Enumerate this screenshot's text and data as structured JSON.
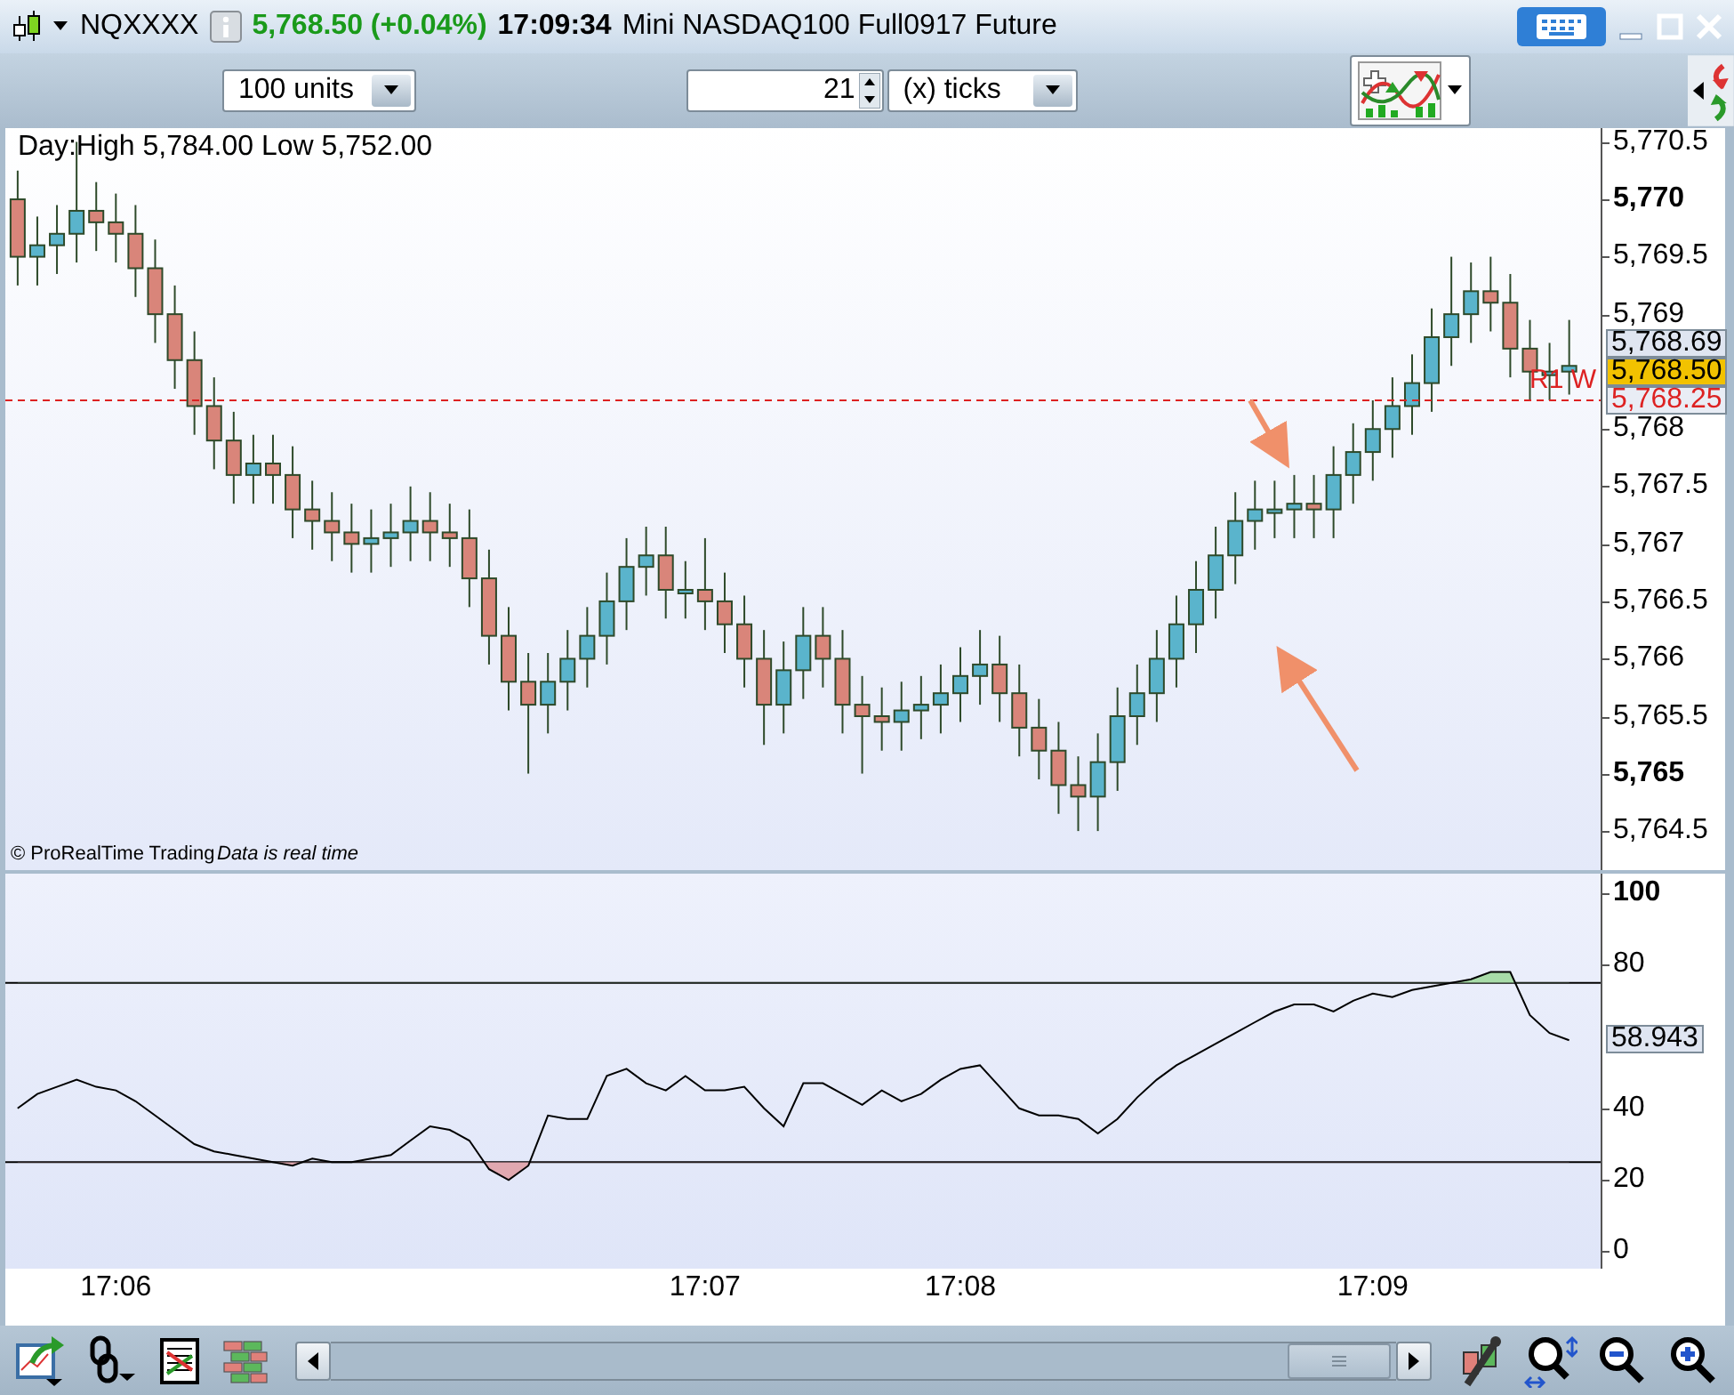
{
  "title_bar": {
    "symbol": "NQXXXX",
    "last_price": "5,768.50 (+0.04%)",
    "time": "17:09:34",
    "description": "Mini NASDAQ100 Full0917 Future"
  },
  "toolbar": {
    "units": "100 units",
    "tick_count": "21",
    "tick_unit": "(x) ticks"
  },
  "price_pane": {
    "day_range": "Day:High 5,784.00 Low 5,752.00",
    "copyright": "© ProRealTime Trading",
    "data_note": "Data is real time",
    "level_label": "R1 W",
    "markers": [
      {
        "kind": "last",
        "text": "5,768.69"
      },
      {
        "kind": "price",
        "text": "5,768.50"
      },
      {
        "kind": "level",
        "text": "5,768.25"
      }
    ],
    "chart_data": {
      "type": "candlestick",
      "ylim": [
        5764.16,
        5770.62
      ],
      "yticks": [
        {
          "value": 5770.5,
          "label": "5,770.5"
        },
        {
          "value": 5770,
          "label": "5,770"
        },
        {
          "value": 5769.5,
          "label": "5,769.5"
        },
        {
          "value": 5769,
          "label": "5,769"
        },
        {
          "value": 5768,
          "label": "5,768"
        },
        {
          "value": 5767.5,
          "label": "5,767.5"
        },
        {
          "value": 5767,
          "label": "5,767"
        },
        {
          "value": 5766.5,
          "label": "5,766.5"
        },
        {
          "value": 5766,
          "label": "5,766"
        },
        {
          "value": 5765.5,
          "label": "5,765.5"
        },
        {
          "value": 5765,
          "label": "5,765"
        },
        {
          "value": 5764.5,
          "label": "5,764.5"
        }
      ],
      "categories": [
        null,
        null,
        null,
        null,
        null,
        null,
        null,
        null,
        null,
        null,
        null,
        null,
        null,
        null,
        null,
        null,
        null,
        null,
        null,
        null,
        null,
        null,
        null,
        null,
        null,
        null,
        null,
        null,
        null,
        null,
        null,
        null,
        null,
        null,
        null,
        null,
        null,
        null,
        null,
        null,
        null,
        null,
        null,
        null,
        null,
        null,
        null,
        null,
        null,
        null,
        null,
        null,
        null,
        null,
        null,
        null,
        null,
        null,
        null,
        null,
        null,
        null,
        null,
        null,
        null,
        null,
        null,
        null,
        null,
        null,
        null,
        null,
        null,
        null,
        null,
        null,
        null,
        null,
        null,
        null
      ],
      "ohlc": [
        [
          5770.0,
          5770.25,
          5769.25,
          5769.5
        ],
        [
          5769.5,
          5769.85,
          5769.25,
          5769.6
        ],
        [
          5769.6,
          5769.95,
          5769.35,
          5769.7
        ],
        [
          5769.7,
          5770.5,
          5769.45,
          5769.9
        ],
        [
          5769.9,
          5770.15,
          5769.55,
          5769.8
        ],
        [
          5769.8,
          5770.05,
          5769.45,
          5769.7
        ],
        [
          5769.7,
          5769.95,
          5769.15,
          5769.4
        ],
        [
          5769.4,
          5769.65,
          5768.75,
          5769.0
        ],
        [
          5769.0,
          5769.25,
          5768.35,
          5768.6
        ],
        [
          5768.6,
          5768.85,
          5767.95,
          5768.2
        ],
        [
          5768.2,
          5768.45,
          5767.65,
          5767.9
        ],
        [
          5767.9,
          5768.15,
          5767.35,
          5767.6
        ],
        [
          5767.6,
          5767.95,
          5767.35,
          5767.7
        ],
        [
          5767.7,
          5767.95,
          5767.35,
          5767.6
        ],
        [
          5767.6,
          5767.85,
          5767.05,
          5767.3
        ],
        [
          5767.3,
          5767.55,
          5766.95,
          5767.2
        ],
        [
          5767.2,
          5767.45,
          5766.85,
          5767.1
        ],
        [
          5767.1,
          5767.35,
          5766.75,
          5767.0
        ],
        [
          5767.0,
          5767.3,
          5766.75,
          5767.05
        ],
        [
          5767.05,
          5767.35,
          5766.8,
          5767.1
        ],
        [
          5767.1,
          5767.5,
          5766.85,
          5767.2
        ],
        [
          5767.2,
          5767.45,
          5766.85,
          5767.1
        ],
        [
          5767.1,
          5767.35,
          5766.8,
          5767.05
        ],
        [
          5767.05,
          5767.3,
          5766.45,
          5766.7
        ],
        [
          5766.7,
          5766.95,
          5765.95,
          5766.2
        ],
        [
          5766.2,
          5766.45,
          5765.55,
          5765.8
        ],
        [
          5765.8,
          5766.05,
          5765.0,
          5765.6
        ],
        [
          5765.6,
          5766.05,
          5765.35,
          5765.8
        ],
        [
          5765.8,
          5766.25,
          5765.55,
          5766.0
        ],
        [
          5766.0,
          5766.45,
          5765.75,
          5766.2
        ],
        [
          5766.2,
          5766.75,
          5765.95,
          5766.5
        ],
        [
          5766.5,
          5767.05,
          5766.25,
          5766.8
        ],
        [
          5766.8,
          5767.15,
          5766.55,
          5766.9
        ],
        [
          5766.9,
          5767.15,
          5766.35,
          5766.6
        ],
        [
          5766.6,
          5766.85,
          5766.35,
          5766.6
        ],
        [
          5766.6,
          5767.05,
          5766.25,
          5766.5
        ],
        [
          5766.5,
          5766.75,
          5766.05,
          5766.3
        ],
        [
          5766.3,
          5766.55,
          5765.75,
          5766.0
        ],
        [
          5766.0,
          5766.25,
          5765.25,
          5765.6
        ],
        [
          5765.6,
          5766.15,
          5765.35,
          5765.9
        ],
        [
          5765.9,
          5766.45,
          5765.65,
          5766.2
        ],
        [
          5766.2,
          5766.45,
          5765.75,
          5766.0
        ],
        [
          5766.0,
          5766.25,
          5765.35,
          5765.6
        ],
        [
          5765.6,
          5765.85,
          5765.0,
          5765.5
        ],
        [
          5765.5,
          5765.75,
          5765.2,
          5765.45
        ],
        [
          5765.45,
          5765.8,
          5765.2,
          5765.55
        ],
        [
          5765.55,
          5765.85,
          5765.3,
          5765.6
        ],
        [
          5765.6,
          5765.95,
          5765.35,
          5765.7
        ],
        [
          5765.7,
          5766.1,
          5765.45,
          5765.85
        ],
        [
          5765.85,
          5766.25,
          5765.6,
          5765.95
        ],
        [
          5765.95,
          5766.2,
          5765.45,
          5765.7
        ],
        [
          5765.7,
          5765.95,
          5765.15,
          5765.4
        ],
        [
          5765.4,
          5765.65,
          5764.95,
          5765.2
        ],
        [
          5765.2,
          5765.45,
          5764.65,
          5764.9
        ],
        [
          5764.9,
          5765.15,
          5764.5,
          5764.8
        ],
        [
          5764.8,
          5765.35,
          5764.5,
          5765.1
        ],
        [
          5765.1,
          5765.75,
          5764.85,
          5765.5
        ],
        [
          5765.5,
          5765.95,
          5765.25,
          5765.7
        ],
        [
          5765.7,
          5766.25,
          5765.45,
          5766.0
        ],
        [
          5766.0,
          5766.55,
          5765.75,
          5766.3
        ],
        [
          5766.3,
          5766.85,
          5766.05,
          5766.6
        ],
        [
          5766.6,
          5767.15,
          5766.35,
          5766.9
        ],
        [
          5766.9,
          5767.45,
          5766.65,
          5767.2
        ],
        [
          5767.2,
          5767.55,
          5766.95,
          5767.3
        ],
        [
          5767.3,
          5767.55,
          5767.05,
          5767.3
        ],
        [
          5767.3,
          5767.6,
          5767.05,
          5767.35
        ],
        [
          5767.35,
          5767.6,
          5767.05,
          5767.3
        ],
        [
          5767.3,
          5767.85,
          5767.05,
          5767.6
        ],
        [
          5767.6,
          5768.05,
          5767.35,
          5767.8
        ],
        [
          5767.8,
          5768.25,
          5767.55,
          5768.0
        ],
        [
          5768.0,
          5768.45,
          5767.75,
          5768.2
        ],
        [
          5768.2,
          5768.65,
          5767.95,
          5768.4
        ],
        [
          5768.4,
          5769.05,
          5768.15,
          5768.8
        ],
        [
          5768.8,
          5769.5,
          5768.55,
          5769.0
        ],
        [
          5769.0,
          5769.45,
          5768.75,
          5769.2
        ],
        [
          5769.2,
          5769.5,
          5768.85,
          5769.1
        ],
        [
          5769.1,
          5769.35,
          5768.45,
          5768.7
        ],
        [
          5768.7,
          5768.95,
          5768.25,
          5768.5
        ],
        [
          5768.5,
          5768.75,
          5768.25,
          5768.5
        ],
        [
          5768.5,
          5768.95,
          5768.3,
          5768.55
        ]
      ],
      "ref_lines": [
        {
          "axis": "y",
          "value": 5768.25
        }
      ]
    }
  },
  "indicator_pane": {
    "reading": "58.943",
    "chart_data": {
      "type": "line",
      "ylim": [
        -4.73,
        100
      ],
      "yticks": [
        100,
        80,
        40,
        20,
        0
      ],
      "ref_lines": [
        {
          "axis": "y",
          "value": 75
        },
        {
          "axis": "y",
          "value": 25
        }
      ],
      "categories": [
        null,
        null,
        null,
        null,
        null,
        "17:06",
        null,
        null,
        null,
        null,
        null,
        null,
        null,
        null,
        null,
        null,
        null,
        null,
        null,
        null,
        null,
        null,
        null,
        null,
        null,
        null,
        null,
        null,
        null,
        null,
        null,
        null,
        null,
        null,
        null,
        "17:07",
        null,
        null,
        null,
        null,
        null,
        null,
        null,
        null,
        null,
        null,
        null,
        null,
        "17:08",
        null,
        null,
        null,
        null,
        null,
        null,
        null,
        null,
        null,
        null,
        null,
        null,
        null,
        null,
        null,
        null,
        null,
        null,
        null,
        null,
        "17:09",
        null,
        null,
        null,
        null,
        null,
        null,
        null,
        null,
        null,
        null
      ],
      "series": [
        {
          "color": "#000000",
          "values": [
            40,
            44,
            46,
            48,
            46,
            45,
            42,
            38,
            34,
            30,
            28,
            27,
            26,
            25,
            24,
            26,
            25,
            25,
            26,
            27,
            31,
            35,
            34,
            31,
            23,
            20,
            24,
            38,
            37,
            37,
            49,
            51,
            47,
            45,
            49,
            45,
            45,
            46,
            40,
            35,
            47,
            47,
            44,
            41,
            45,
            42,
            44,
            48,
            51,
            52,
            46,
            40,
            38,
            38,
            37,
            33,
            37,
            43,
            48,
            52,
            55,
            58,
            61,
            64,
            67,
            69,
            69,
            67,
            70,
            72,
            71,
            73,
            74,
            75,
            76,
            78,
            78,
            66,
            61,
            59
          ]
        }
      ]
    }
  }
}
